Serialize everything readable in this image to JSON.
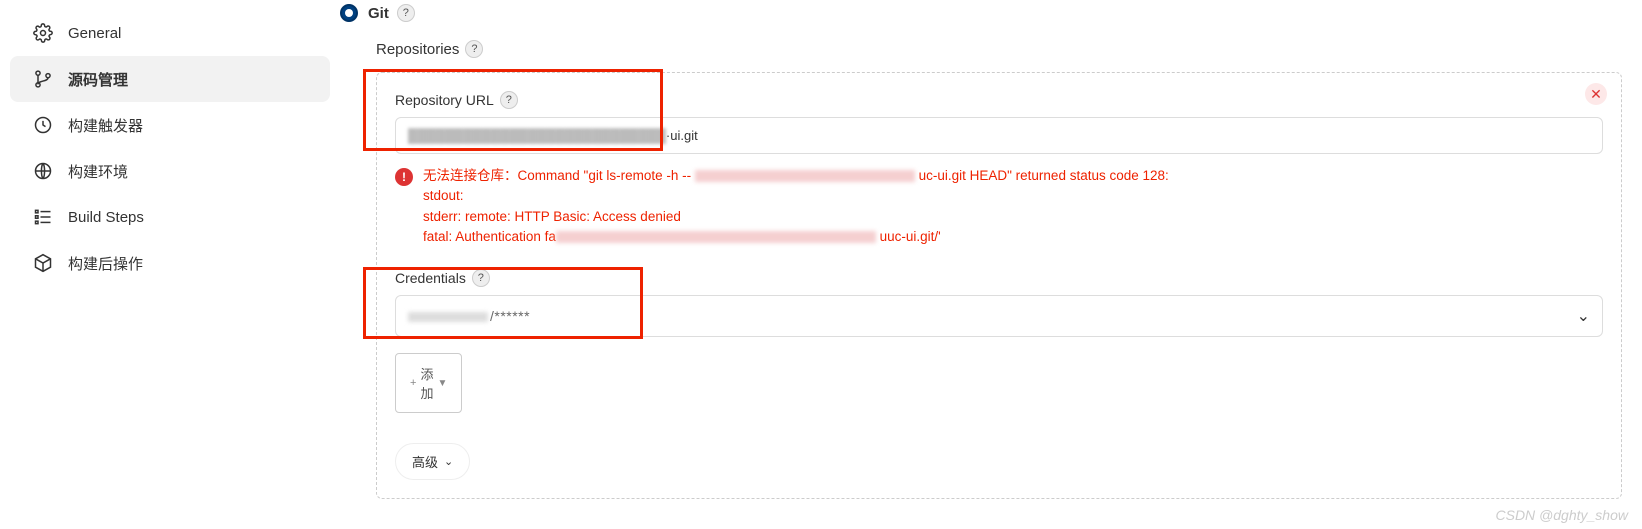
{
  "sidebar": {
    "items": [
      {
        "label": "General"
      },
      {
        "label": "源码管理"
      },
      {
        "label": "构建触发器"
      },
      {
        "label": "构建环境"
      },
      {
        "label": "Build Steps"
      },
      {
        "label": "构建后操作"
      }
    ]
  },
  "scm": {
    "git_label": "Git",
    "help": "?",
    "repositories_label": "Repositories",
    "repo": {
      "url_label": "Repository URL",
      "url_value_suffix": "·ui.git",
      "close": "✕",
      "error": {
        "line1_pre": "无法连接仓库：Command \"git ls-remote -h -- ",
        "line1_post": " uc-ui.git HEAD\" returned status code 128:",
        "line2": "stdout:",
        "line3": "stderr: remote: HTTP Basic: Access denied",
        "line4_pre": "fatal: Authentication fa",
        "line4_post": " uuc-ui.git/'"
      },
      "credentials_label": "Credentials",
      "credentials_value": "/******",
      "add_label": "添\n加",
      "advanced_label": "高级"
    }
  },
  "watermark": "CSDN @dghty_show"
}
